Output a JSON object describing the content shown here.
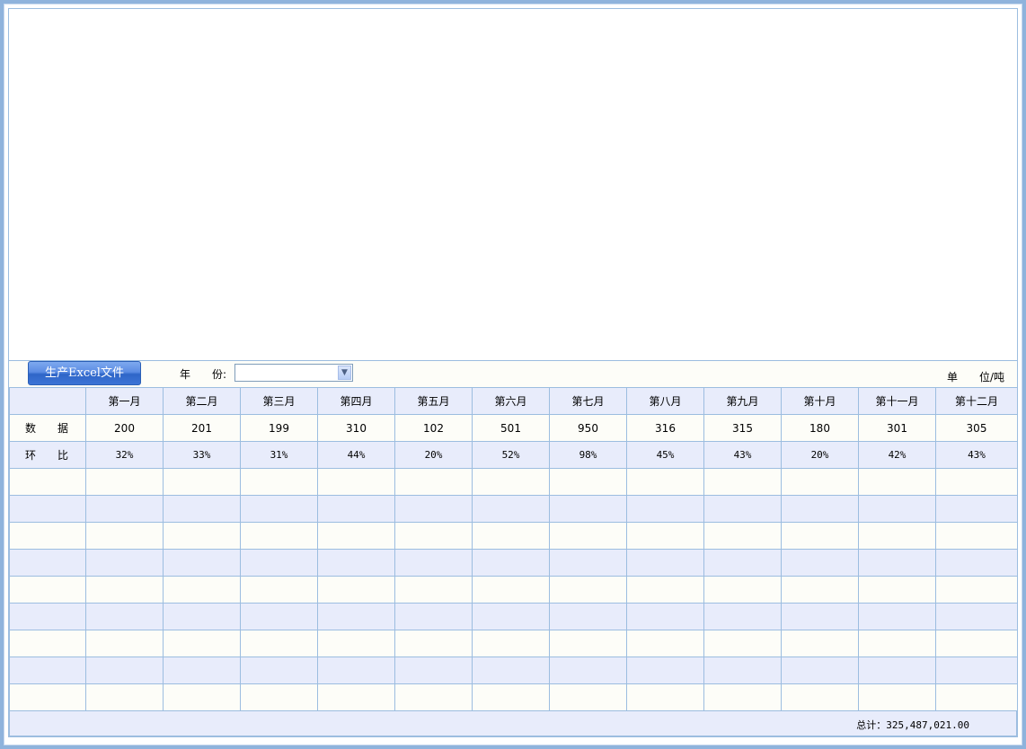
{
  "toolbar": {
    "excel_button_label": "生产Excel文件",
    "year_label_1": "年",
    "year_label_2": "份:",
    "year_value": "",
    "unit_label": "单　　位/吨"
  },
  "table": {
    "headers": [
      "",
      "第一月",
      "第二月",
      "第三月",
      "第四月",
      "第五月",
      "第六月",
      "第七月",
      "第八月",
      "第九月",
      "第十月",
      "第十一月",
      "第十二月"
    ],
    "rows": [
      {
        "label": "数　　据",
        "cells": [
          "200",
          "201",
          "199",
          "310",
          "102",
          "501",
          "950",
          "316",
          "315",
          "180",
          "301",
          "305"
        ]
      },
      {
        "label": "环　　比",
        "cells": [
          "32%",
          "33%",
          "31%",
          "44%",
          "20%",
          "52%",
          "98%",
          "45%",
          "43%",
          "20%",
          "42%",
          "43%"
        ]
      }
    ],
    "empty_row_count": 9
  },
  "footer": {
    "total": "总计：325,487,021.00"
  }
}
